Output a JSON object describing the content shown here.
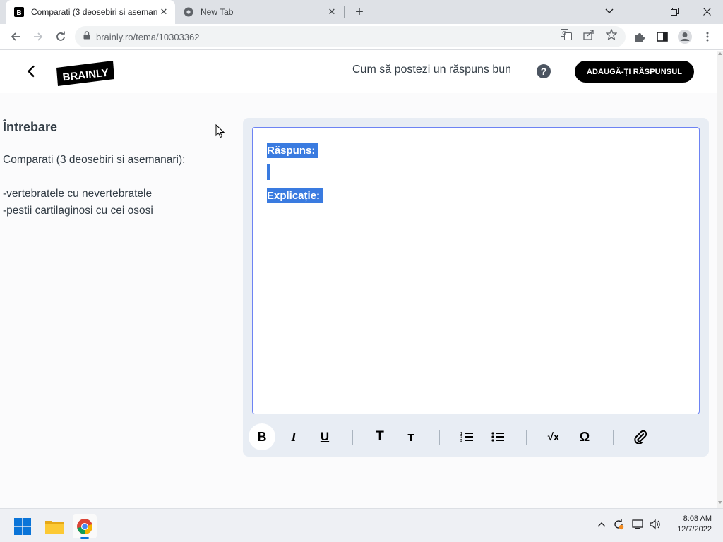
{
  "browser": {
    "tabs": [
      {
        "title": "Comparati (3 deosebiri si asemanari)",
        "active": true
      },
      {
        "title": "New Tab",
        "active": false
      }
    ],
    "url": "brainly.ro/tema/10303362"
  },
  "header": {
    "logo": "BRAINLY",
    "help_text": "Cum să postezi un răspuns bun",
    "help_icon": "?",
    "add_answer_label": "ADAUGĂ-ȚI RĂSPUNSUL"
  },
  "question": {
    "heading": "Întrebare",
    "lines": [
      "Comparati (3 deosebiri si asemanari):",
      "-vertebratele cu nevertebratele",
      "-pestii cartilaginosi cu cei ososi"
    ]
  },
  "editor": {
    "answer_label": "Răspuns:",
    "explanation_label": "Explicație:",
    "toolbar": [
      {
        "icon": "bold-icon",
        "glyph": "B"
      },
      {
        "icon": "italic-icon",
        "glyph": "I"
      },
      {
        "icon": "underline-icon",
        "glyph": "U"
      },
      {
        "icon": "heading-large-icon",
        "glyph": "T"
      },
      {
        "icon": "heading-small-icon",
        "glyph": "T"
      },
      {
        "icon": "ordered-list-icon"
      },
      {
        "icon": "bullet-list-icon"
      },
      {
        "icon": "math-sqrt-icon",
        "glyph": "√x"
      },
      {
        "icon": "omega-symbol-icon",
        "glyph": "Ω"
      },
      {
        "icon": "attachment-icon"
      }
    ]
  },
  "taskbar": {
    "time": "8:08 AM",
    "date": "12/7/2022"
  },
  "colors": {
    "selection": "#3a7be0",
    "editor_border": "#6d83f3",
    "button_bg": "#000000"
  }
}
